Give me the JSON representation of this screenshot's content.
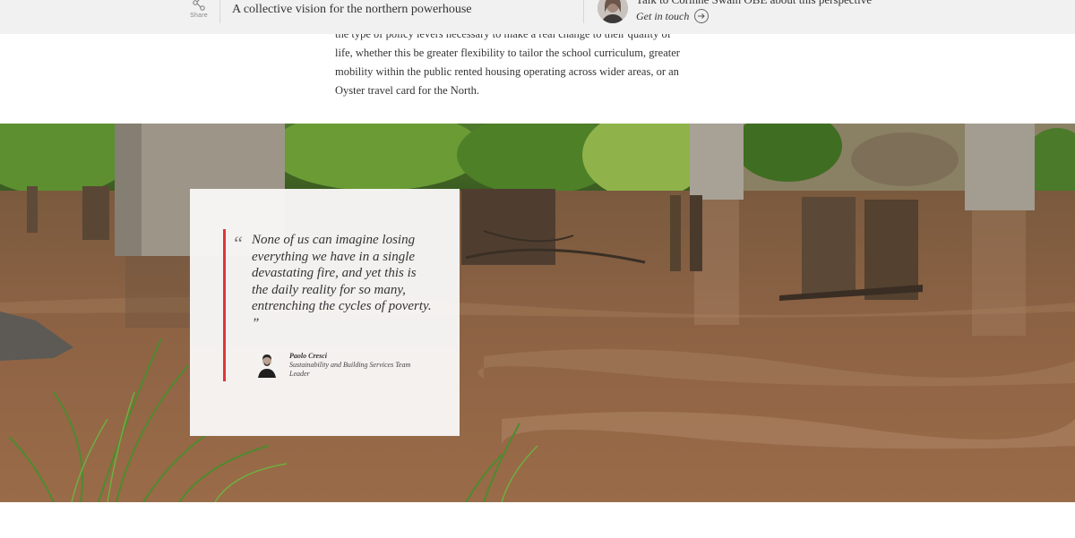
{
  "topbar": {
    "share_label": "Share",
    "article_title": "A collective vision for the northern powerhouse",
    "contact_line": "Talk to Corinne Swain OBE about this perspective",
    "contact_cta": "Get in touch"
  },
  "article": {
    "lines": [
      "the type of policy levers necessary to make a real change to their quality of",
      "life, whether this be greater flexibility to tailor the school curriculum, greater",
      "mobility within the public rented housing operating across wider areas, or an",
      "Oyster travel card for the North."
    ]
  },
  "quote": {
    "mark": "“",
    "text": "None of us can imagine losing everything we have in a single devastating fire, and yet this is the daily reality for so many, entrenching the cycles of poverty. ”",
    "author_name": "Paolo Cresci",
    "author_role": "Sustainability and Building Services Team Leader"
  },
  "colors": {
    "topbar_bg": "#f1f1f1",
    "quote_accent": "#e0353b",
    "river_water": "#8a5a3a"
  },
  "icons": [
    "share-icon",
    "arrow-right-icon"
  ]
}
